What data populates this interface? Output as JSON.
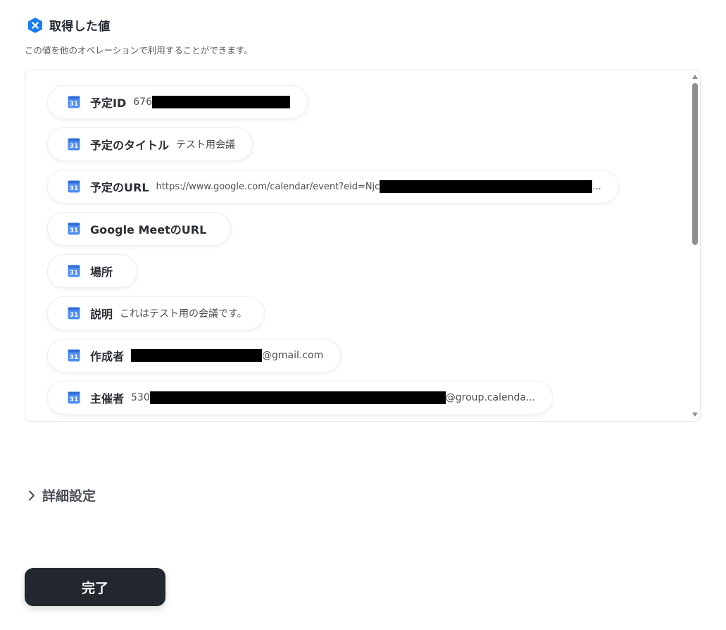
{
  "header": {
    "title": "取得した値",
    "subtitle": "この値を他のオペレーションで利用することができます。",
    "icon": "hexagon-x-icon",
    "icon_color": "#1a7cf2"
  },
  "fields": [
    {
      "label": "予定ID",
      "prefix": "676",
      "suffix": ""
    },
    {
      "label": "予定のタイトル",
      "prefix": "テスト用会議",
      "suffix": ""
    },
    {
      "label": "予定のURL",
      "prefix": "https://www.google.com/calendar/event?eid=Njc",
      "suffix": "..."
    },
    {
      "label": "Google MeetのURL",
      "prefix": "",
      "suffix": ""
    },
    {
      "label": "場所",
      "prefix": "",
      "suffix": ""
    },
    {
      "label": "説明",
      "prefix": "これはテスト用の会議です。",
      "suffix": ""
    },
    {
      "label": "作成者",
      "prefix": "",
      "suffix": "@gmail.com"
    },
    {
      "label": "主催者",
      "prefix": "530",
      "suffix": "@group.calenda..."
    }
  ],
  "field_icon": "google-calendar-icon",
  "details": {
    "label": "詳細設定",
    "icon": "chevron-right-icon"
  },
  "done_button": {
    "label": "完了",
    "color": "#23272e"
  }
}
